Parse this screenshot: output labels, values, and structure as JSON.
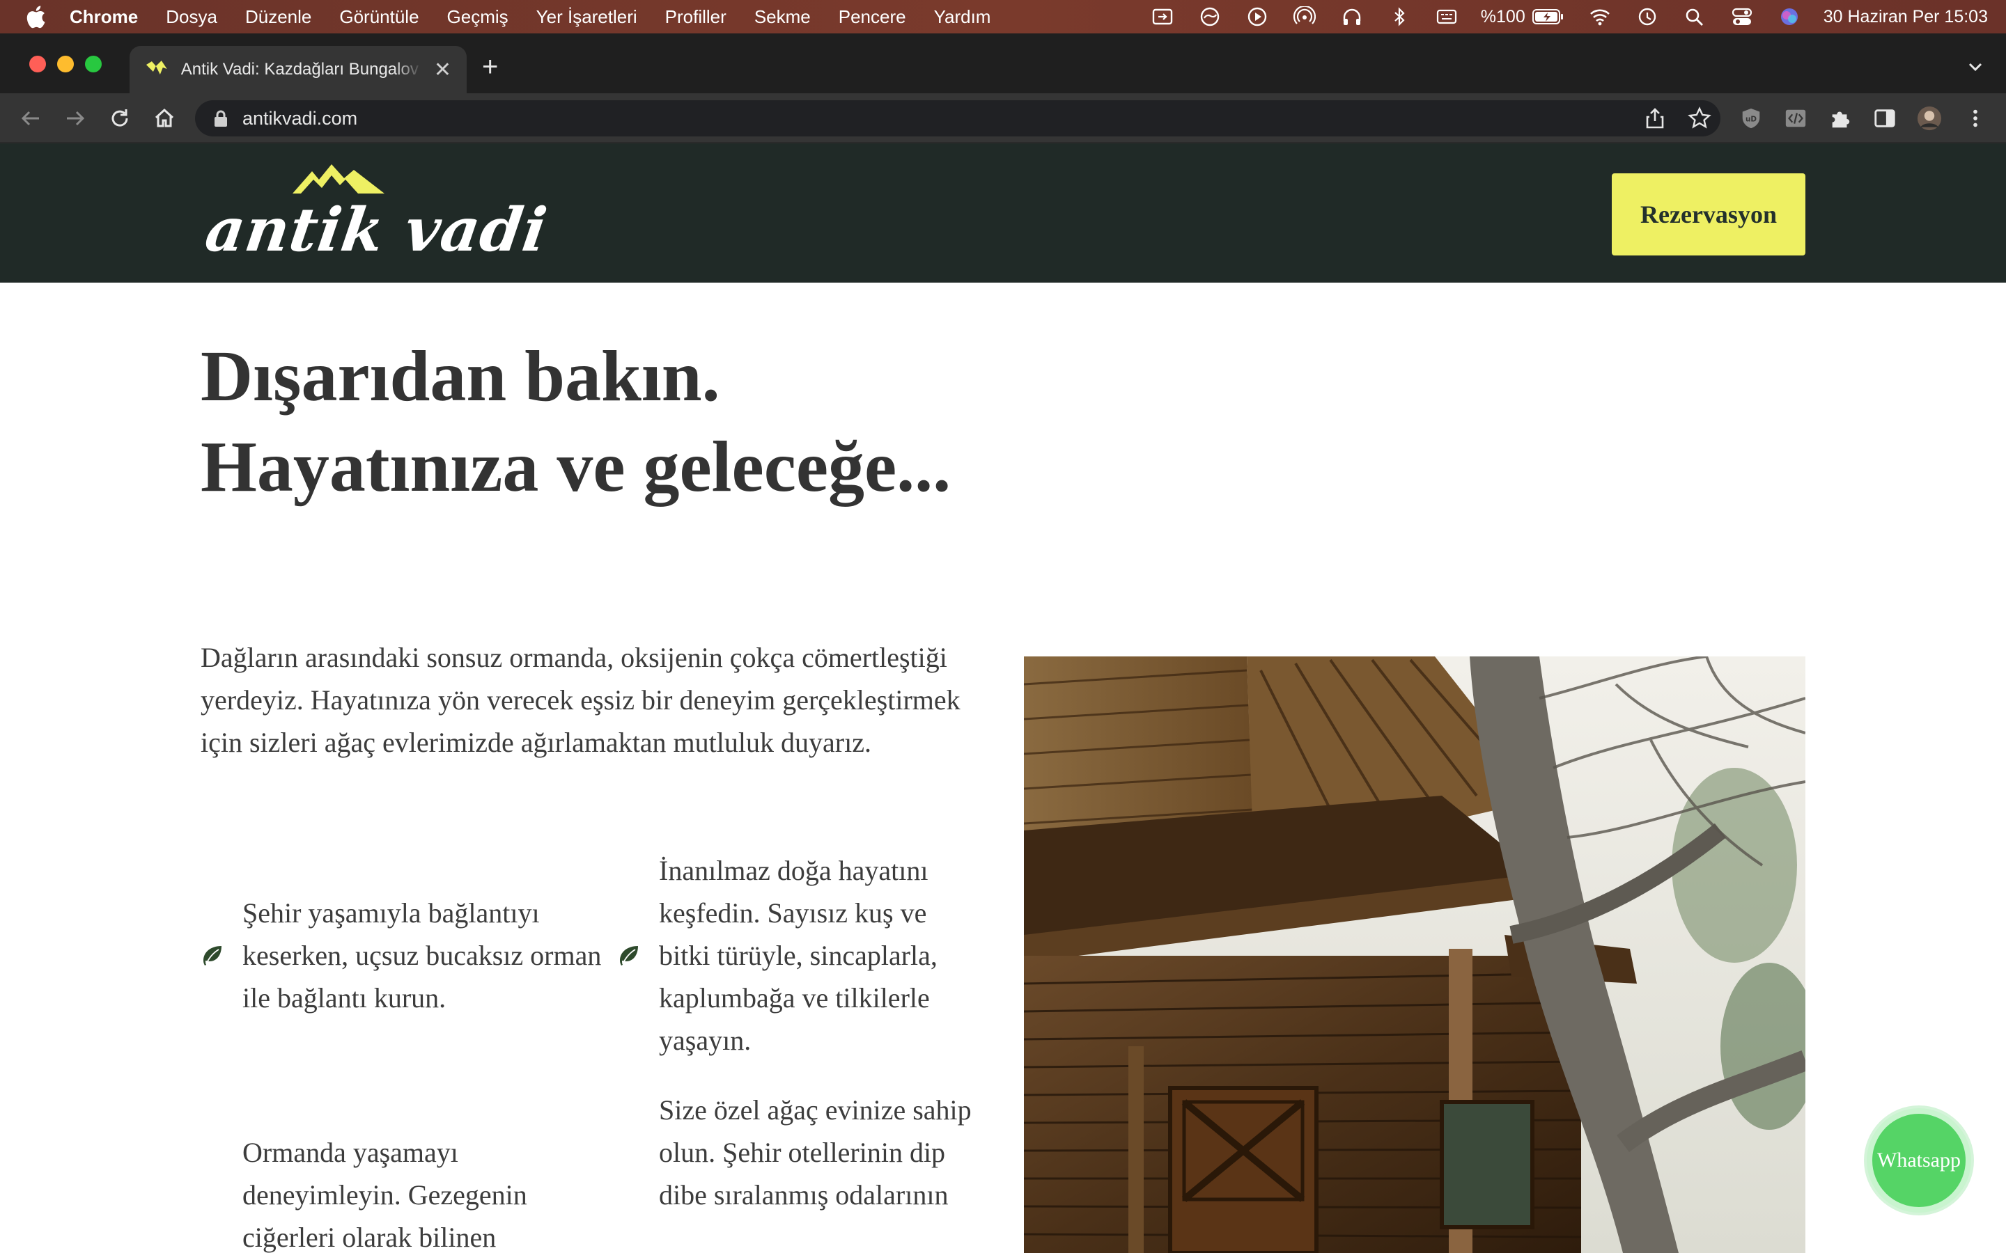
{
  "menubar": {
    "app_name": "Chrome",
    "items": [
      "Dosya",
      "Düzenle",
      "Görüntüle",
      "Geçmiş",
      "Yer İşaretleri",
      "Profiller",
      "Sekme",
      "Pencere",
      "Yardım"
    ],
    "battery": "%100",
    "datetime": "30 Haziran Per  15:03"
  },
  "browser": {
    "tab_title": "Antik Vadi: Kazdağları Bungalov",
    "url": "antikvadi.com"
  },
  "site": {
    "logo_text": "antik vadi",
    "reserve_label": "Rezervasyon",
    "headline": "Dışarıdan bakın. Hayatınıza ve geleceğe...",
    "intro": "Dağların arasındaki sonsuz ormanda, oksijenin çokça cömertleştiği yerdeyiz. Hayatınıza yön verecek eşsiz bir deneyim gerçekleştirmek için sizleri ağaç evlerimizde ağırlamaktan mutluluk duyarız.",
    "features": [
      "Şehir yaşamıyla bağlantıyı keserken, uçsuz bucaksız orman ile bağlantı kurun.",
      "İnanılmaz doğa hayatını keşfedin. Sayısız kuş ve bitki türüyle, sincaplarla, kaplumbağa ve tilkilerle yaşayın.",
      "Ormanda yaşamayı deneyimleyin. Gezegenin ciğerleri olarak bilinen",
      "Size özel ağaç evinize sahip olun. Şehir otellerinin dip dibe sıralanmış odalarının"
    ],
    "whatsapp_label": "Whatsapp"
  },
  "colors": {
    "header_bg": "#202a27",
    "accent": "#eef063",
    "whatsapp": "#55d466"
  }
}
